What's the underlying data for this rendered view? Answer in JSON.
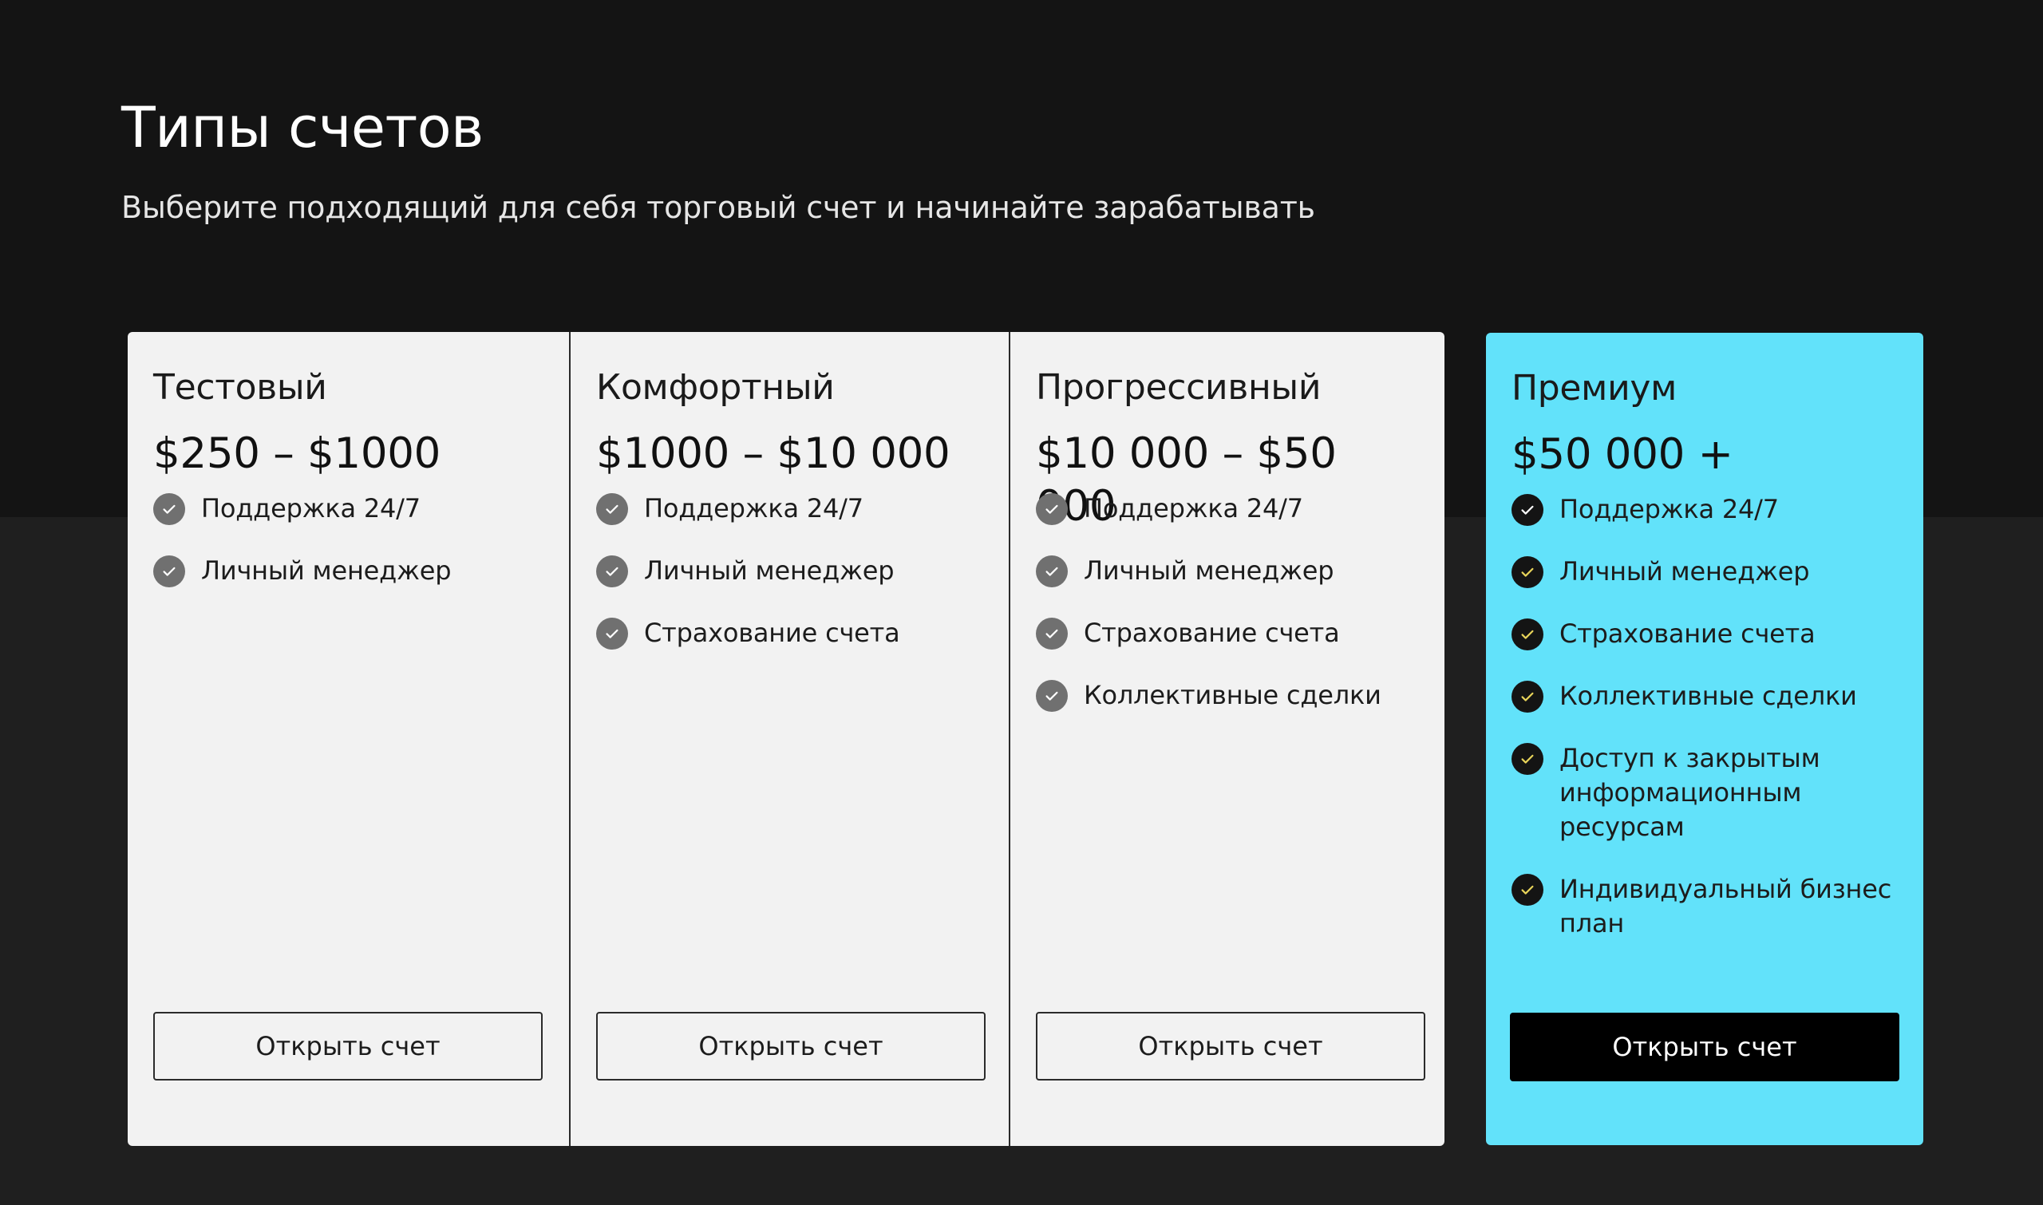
{
  "header": {
    "title": "Типы счетов",
    "subtitle": "Выберите подходящий для себя торговый счет и начинайте зарабатывать"
  },
  "colors": {
    "background_top": "#141414",
    "background_bottom": "#1f1f1f",
    "card": "#f2f2f2",
    "premium_card": "#62e2fa",
    "check_grey": "#707070",
    "check_dark": "#141414",
    "check_mark_premium": "#e8d45a"
  },
  "plans": [
    {
      "name": "Тестовый",
      "price": "$250 – $1000",
      "features": [
        "Поддержка 24/7",
        "Личный менеджер"
      ],
      "button_label": "Открыть счет"
    },
    {
      "name": "Комфортный",
      "price": "$1000 – $10 000",
      "features": [
        "Поддержка 24/7",
        "Личный менеджер",
        "Страхование счета"
      ],
      "button_label": "Открыть счет"
    },
    {
      "name": "Прогрессивный",
      "price": "$10 000 – $50 000",
      "features": [
        "Поддержка 24/7",
        "Личный менеджер",
        "Страхование счета",
        "Коллективные сделки"
      ],
      "button_label": "Открыть счет"
    },
    {
      "name": "Премиум",
      "price": "$50 000 +",
      "features": [
        "Поддержка 24/7",
        "Личный менеджер",
        "Страхование счета",
        "Коллективные сделки",
        "Доступ к закрытым информационным ресурсам",
        "Индивидуальный бизнес план"
      ],
      "button_label": "Открыть счет"
    }
  ],
  "icons": {
    "feature_check": "check-circle-icon"
  }
}
